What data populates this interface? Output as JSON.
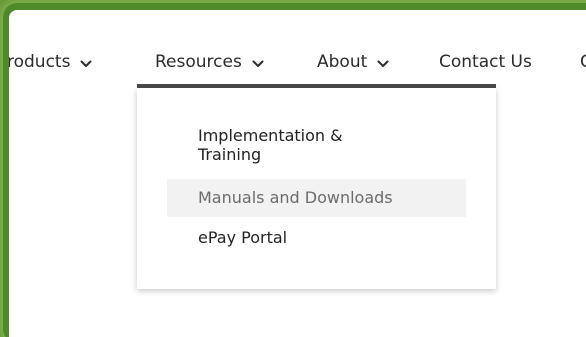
{
  "nav": {
    "items": [
      {
        "label": "roducts",
        "has_dropdown": true
      },
      {
        "label": "Resources",
        "has_dropdown": true,
        "active": true
      },
      {
        "label": "About",
        "has_dropdown": true
      },
      {
        "label": "Contact Us",
        "has_dropdown": false
      },
      {
        "label": "C",
        "has_dropdown": false
      }
    ]
  },
  "dropdown": {
    "items": [
      {
        "label": "Implementation & Training"
      },
      {
        "label": "Manuals and Downloads",
        "hovered": true
      },
      {
        "label": "ePay Portal"
      }
    ]
  },
  "colors": {
    "frame_green": "#4f8a2a",
    "text": "#2b2b2b",
    "underline": "#4a4a4a",
    "hover_bg": "#f2f2f2",
    "muted_text": "#6b6b6b"
  }
}
